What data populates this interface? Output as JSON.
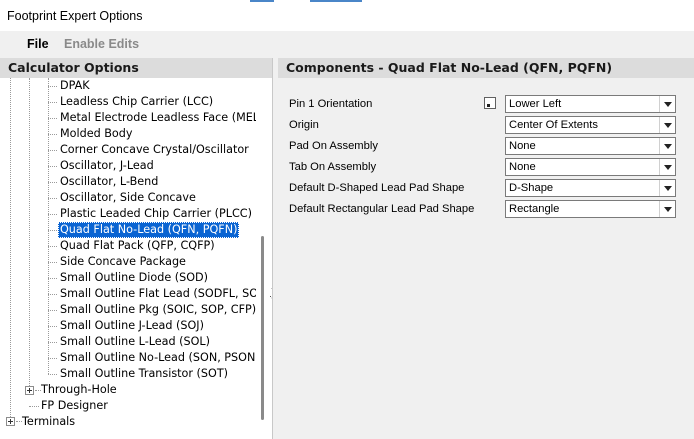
{
  "window": {
    "title": "Footprint Expert Options"
  },
  "menu": {
    "file": "File",
    "enable_edits": "Enable Edits"
  },
  "left_panel": {
    "header": "Calculator Options",
    "items": [
      "DPAK",
      "Leadless Chip Carrier (LCC)",
      "Metal Electrode Leadless Face (MELF)",
      "Molded Body",
      "Corner Concave Crystal/Oscillator",
      "Oscillator, J-Lead",
      "Oscillator, L-Bend",
      "Oscillator, Side Concave",
      "Plastic Leaded Chip Carrier (PLCC)",
      "Quad Flat No-Lead (QFN, PQFN)",
      "Quad Flat Pack (QFP, CQFP)",
      "Side Concave Package",
      "Small Outline Diode (SOD)",
      "Small Outline Flat Lead (SODFL, SOFL)",
      "Small Outline Pkg (SOIC, SOP, CFP)",
      "Small Outline J-Lead (SOJ)",
      "Small Outline L-Lead (SOL)",
      "Small Outline No-Lead (SON, PSON)",
      "Small Outline Transistor (SOT)"
    ],
    "through_hole": "Through-Hole",
    "fp_designer": "FP Designer",
    "terminals": "Terminals",
    "selected_item": "Quad Flat No-Lead (QFN, PQFN)"
  },
  "right_panel": {
    "header": "Components - Quad Flat No-Lead (QFN, PQFN)",
    "properties": [
      {
        "label": "Pin 1 Orientation",
        "value": "Lower Left"
      },
      {
        "label": "Origin",
        "value": "Center Of Extents"
      },
      {
        "label": "Pad On Assembly",
        "value": "None"
      },
      {
        "label": "Tab On Assembly",
        "value": "None"
      },
      {
        "label": "Default D-Shaped Lead Pad Shape",
        "value": "D-Shape"
      },
      {
        "label": "Default Rectangular Lead Pad Shape",
        "value": "Rectangle"
      }
    ]
  },
  "colors": {
    "selection": "#0a64d2",
    "header_bg": "#dcdcdc",
    "window_bg": "#f0f0f0"
  }
}
